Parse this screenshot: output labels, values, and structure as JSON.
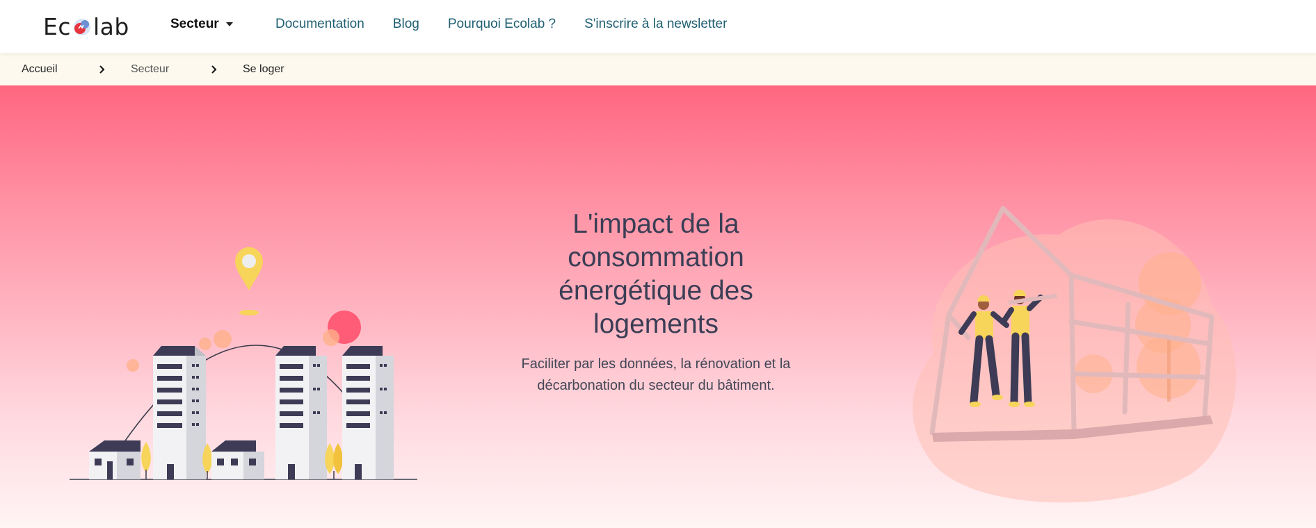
{
  "header": {
    "logo_text_left": "Ec",
    "logo_text_right": "lab",
    "sector_menu_label": "Secteur",
    "nav_links": [
      {
        "label": "Documentation"
      },
      {
        "label": "Blog"
      },
      {
        "label": "Pourquoi Ecolab ?"
      },
      {
        "label": "S'inscrire à la newsletter"
      }
    ]
  },
  "breadcrumb": {
    "items": [
      "Accueil",
      "Secteur",
      "Se loger"
    ]
  },
  "hero": {
    "title": "L'impact de la consommation énergétique des logements",
    "subtitle": "Faciliter par les données, la rénovation et la décarbonation du secteur du bâtiment."
  },
  "colors": {
    "nav_link": "#1f5f72",
    "hero_top": "#ff6680",
    "hero_bottom": "#fff4f5",
    "title_text": "#3a3e55",
    "breadcrumb_bg": "#fdf9ef",
    "accent_yellow": "#f7d45a"
  }
}
